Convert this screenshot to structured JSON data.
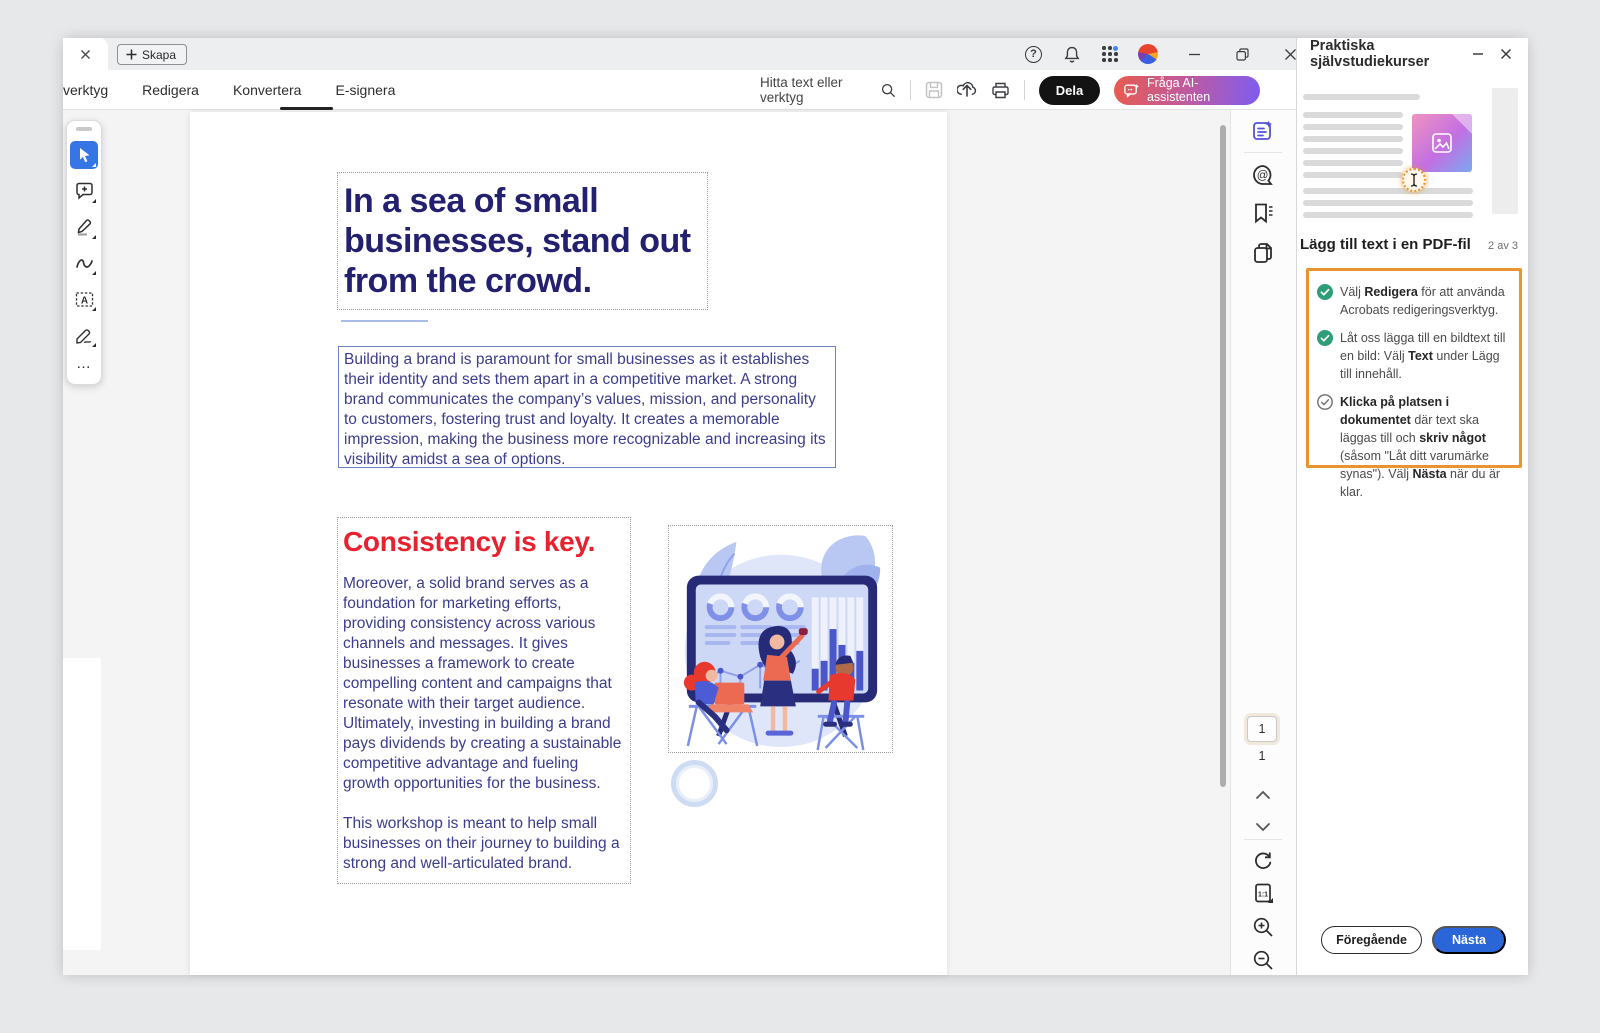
{
  "titlebar": {
    "new_tab_label": "Skapa"
  },
  "menubar": {
    "items": [
      "verktyg",
      "Redigera",
      "Konvertera",
      "E-signera"
    ],
    "active_item": "E-signera",
    "search_label": "Hitta text eller verktyg",
    "share_label": "Dela",
    "ai_label": "Fråga AI-assistenten"
  },
  "document": {
    "heading": "In a sea of small businesses, stand out from the crowd.",
    "intro_paragraph": "Building a brand is paramount for small businesses as it establishes their identity and sets them apart in a competitive market. A strong brand communicates the company’s values, mission, and personality to customers, fostering trust and loyalty. It creates a memorable impression, making the business more recognizable and increasing its visibility amidst a sea of options.",
    "section_heading": "Consistency is key.",
    "section_paragraph_1": "Moreover, a solid brand serves as a foundation for marketing efforts, providing consistency across various channels and messages. It gives businesses a framework to create compelling content and campaigns that resonate with their target audience. Ultimately, investing in building a brand pays dividends by creating a sustainable competitive advantage and fueling growth opportunities for the business.",
    "section_paragraph_2": "This workshop is meant to help small businesses on their journey to building a strong and well-articulated brand."
  },
  "pager": {
    "current_page": "1",
    "total_pages": "1"
  },
  "panel": {
    "title": "Praktiska självstudiekurser",
    "lesson_title": "Lägg till text i en PDF-fil",
    "progress_label": "2 av 3",
    "steps": [
      {
        "done": true,
        "segments": [
          {
            "text": "Välj ",
            "bold": false
          },
          {
            "text": "Redigera",
            "bold": true
          },
          {
            "text": " för att använda Acrobats redigeringsverktyg.",
            "bold": false
          }
        ]
      },
      {
        "done": true,
        "segments": [
          {
            "text": "Låt oss lägga till en bildtext till en bild: Välj ",
            "bold": false
          },
          {
            "text": "Text",
            "bold": true
          },
          {
            "text": " under Lägg till innehåll.",
            "bold": false
          }
        ]
      },
      {
        "done": false,
        "segments": [
          {
            "text": "Klicka på platsen i dokumentet",
            "bold": true
          },
          {
            "text": " där text ska läggas till och ",
            "bold": false
          },
          {
            "text": "skriv något",
            "bold": true
          },
          {
            "text": " (såsom \"Låt ditt varumärke synas\"). Välj ",
            "bold": false
          },
          {
            "text": "Nästa",
            "bold": true
          },
          {
            "text": " när du är klar.",
            "bold": false
          }
        ]
      }
    ],
    "previous_label": "Föregående",
    "next_label": "Nästa"
  },
  "colors": {
    "accent_blue": "#2B66D9",
    "tool_active_blue": "#3575E5",
    "panel_highlight_orange": "#E8952F",
    "step_done_green": "#2E9D78",
    "ai_gradient_start": "#E85B4F",
    "ai_gradient_end": "#7E5CF0",
    "doc_heading_navy": "#23206F",
    "doc_body_blue": "#3C3C8E",
    "doc_red": "#E8212E"
  }
}
